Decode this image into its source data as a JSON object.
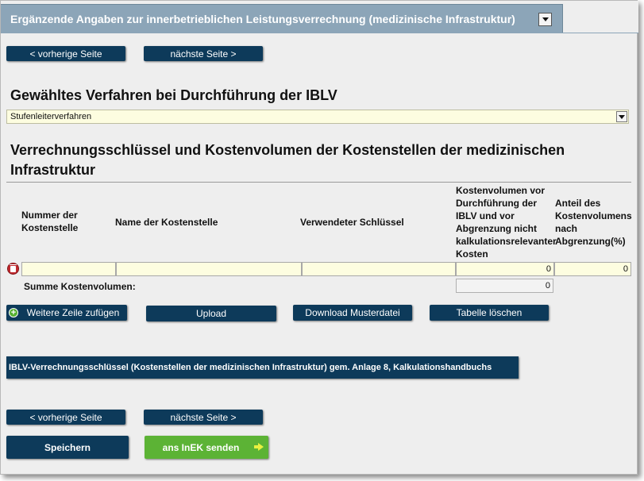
{
  "tab": {
    "title": "Ergänzende Angaben zur innerbetrieblichen Leistungsverrechnung (medizinische Infrastruktur)"
  },
  "nav": {
    "prev_label": "< vorherige Seite",
    "next_label": "nächste Seite >"
  },
  "procedure": {
    "heading": "Gewähltes Verfahren bei Durchführung der IBLV",
    "selected": "Stufenleiterverfahren"
  },
  "allocation": {
    "heading": "Verrechnungsschlüssel und Kostenvolumen der Kostenstellen der medizinischen Infrastruktur",
    "columns": [
      "Nummer der Kostenstelle",
      "Name der Kostenstelle",
      "Verwendeter Schlüssel",
      "Kostenvolumen vor Durchführung der IBLV und vor Abgrenzung nicht kalkulationsrelevanter Kosten",
      "Anteil des Kostenvolumens nach Abgrenzung(%)"
    ],
    "rows": [
      {
        "nummer": "",
        "name": "",
        "schluessel": "",
        "kostenvolumen": "0",
        "anteil": "0"
      }
    ],
    "sum_label": "Summe Kostenvolumen:",
    "sum_value": "0"
  },
  "actions": {
    "add_row": "Weitere Zeile zufügen",
    "upload": "Upload",
    "download": "Download Musterdatei",
    "clear": "Tabelle löschen"
  },
  "iblv_section": {
    "label": "IBLV-Verrechnungsschlüssel (Kostenstellen der medizinischen Infrastruktur) gem. Anlage 8, Kalkulationshandbuchs"
  },
  "footer": {
    "save": "Speichern",
    "send": "ans InEK senden"
  }
}
